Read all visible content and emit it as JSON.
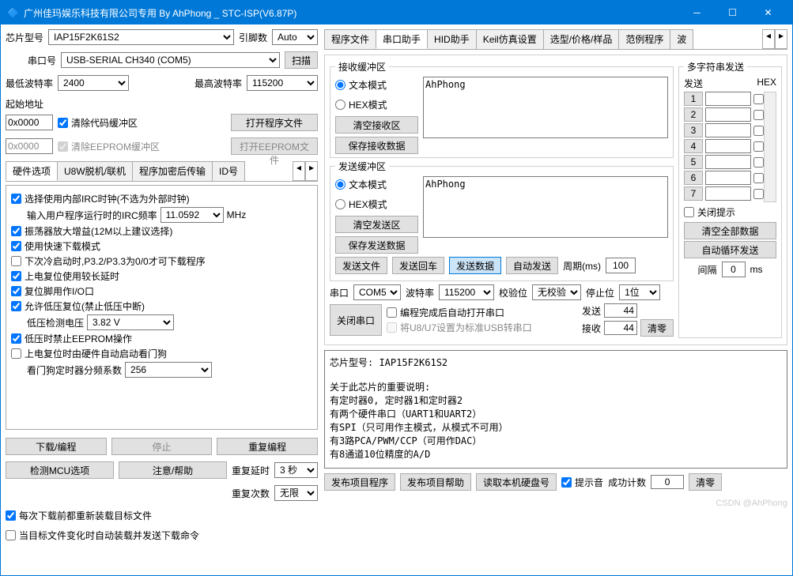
{
  "window": {
    "title": "广州佳玛娱乐科技有限公司专用 By AhPhong _ STC-ISP(V6.87P)"
  },
  "left": {
    "chip_model_lbl": "芯片型号",
    "chip_model": "IAP15F2K61S2",
    "pin_count_lbl": "引脚数",
    "pin_count": "Auto",
    "port_lbl": "串口号",
    "port": "USB-SERIAL CH340 (COM5)",
    "scan_btn": "扫描",
    "min_baud_lbl": "最低波特率",
    "min_baud": "2400",
    "max_baud_lbl": "最高波特率",
    "max_baud": "115200",
    "start_addr_lbl": "起始地址",
    "addr1": "0x0000",
    "clear_code_cb": "清除代码缓冲区",
    "open_prog_btn": "打开程序文件",
    "addr2": "0x0000",
    "clear_eeprom_cb": "清除EEPROM缓冲区",
    "open_eeprom_btn": "打开EEPROM文件",
    "tabs": [
      "硬件选项",
      "U8W脱机/联机",
      "程序加密后传输",
      "ID号"
    ],
    "hw": {
      "irc_cb": "选择使用内部IRC时钟(不选为外部时钟)",
      "irc_freq_lbl": "输入用户程序运行时的IRC频率",
      "irc_freq": "11.0592",
      "irc_unit": "MHz",
      "osc_gain_cb": "振荡器放大增益(12M以上建议选择)",
      "fast_dl_cb": "使用快速下载模式",
      "cold_start_cb": "下次冷启动时,P3.2/P3.3为0/0才可下载程序",
      "long_delay_cb": "上电复位使用较长延时",
      "reset_io_cb": "复位脚用作I/O口",
      "lv_reset_cb": "允许低压复位(禁止低压中断)",
      "lv_detect_lbl": "低压检测电压",
      "lv_detect": "3.82 V",
      "lv_eeprom_cb": "低压时禁止EEPROM操作",
      "wdt_cb": "上电复位时由硬件自动启动看门狗",
      "wdt_div_lbl": "看门狗定时器分频系数",
      "wdt_div": "256"
    },
    "download_btn": "下载/编程",
    "stop_btn": "停止",
    "reprog_btn": "重复编程",
    "detect_btn": "检测MCU选项",
    "help_btn": "注意/帮助",
    "repeat_delay_lbl": "重复延时",
    "repeat_delay": "3 秒",
    "repeat_count_lbl": "重复次数",
    "repeat_count": "无限",
    "reload_cb": "每次下载前都重新装载目标文件",
    "auto_send_cb": "当目标文件变化时自动装载并发送下载命令"
  },
  "right": {
    "tabs": [
      "程序文件",
      "串口助手",
      "HID助手",
      "Keil仿真设置",
      "选型/价格/样品",
      "范例程序",
      "波"
    ],
    "recv_buf_lbl": "接收缓冲区",
    "text_mode": "文本模式",
    "hex_mode": "HEX模式",
    "clear_recv": "清空接收区",
    "save_recv": "保存接收数据",
    "recv_text": "AhPhong",
    "send_buf_lbl": "发送缓冲区",
    "clear_send": "清空发送区",
    "save_send": "保存发送数据",
    "send_text": "AhPhong",
    "send_file": "发送文件",
    "send_enter": "发送回车",
    "send_data": "发送数据",
    "auto_send": "自动发送",
    "period_lbl": "周期(ms)",
    "period": "100",
    "multisend_lbl": "多字符串发送",
    "send_hdr": "发送",
    "hex_hdr": "HEX",
    "ms_nums": [
      "1",
      "2",
      "3",
      "4",
      "5",
      "6",
      "7"
    ],
    "close_hint_cb": "关闭提示",
    "clear_all": "清空全部数据",
    "auto_loop": "自动循环发送",
    "interval_lbl": "间隔",
    "interval": "0",
    "ms_unit": "ms",
    "serial_lbl": "串口",
    "serial": "COM5",
    "baud_lbl": "波特率",
    "baud": "115200",
    "parity_lbl": "校验位",
    "parity": "无校验",
    "stop_lbl": "停止位",
    "stop": "1位",
    "close_port": "关闭串口",
    "auto_open_cb": "编程完成后自动打开串口",
    "u8_cb": "将U8/U7设置为标准USB转串口",
    "sent_lbl": "发送",
    "sent_count": "44",
    "recv_lbl": "接收",
    "recv_count": "44",
    "clear_btn": "清零",
    "info": "芯片型号: IAP15F2K61S2\n\n关于此芯片的重要说明:\n  有定时器0, 定时器1和定时器2\n  有两个硬件串口（UART1和UART2）\n  有SPI（只可用作主模式，从模式不可用）\n  有3路PCA/PWM/CCP（可用作DAC）\n  有8通道10位精度的A/D",
    "pub_prog": "发布项目程序",
    "pub_help": "发布项目帮助",
    "read_hdd": "读取本机硬盘号",
    "hint_cb": "提示音",
    "success_lbl": "成功计数",
    "success": "0",
    "clear2": "清零",
    "watermark": "CSDN @AhPhong"
  }
}
